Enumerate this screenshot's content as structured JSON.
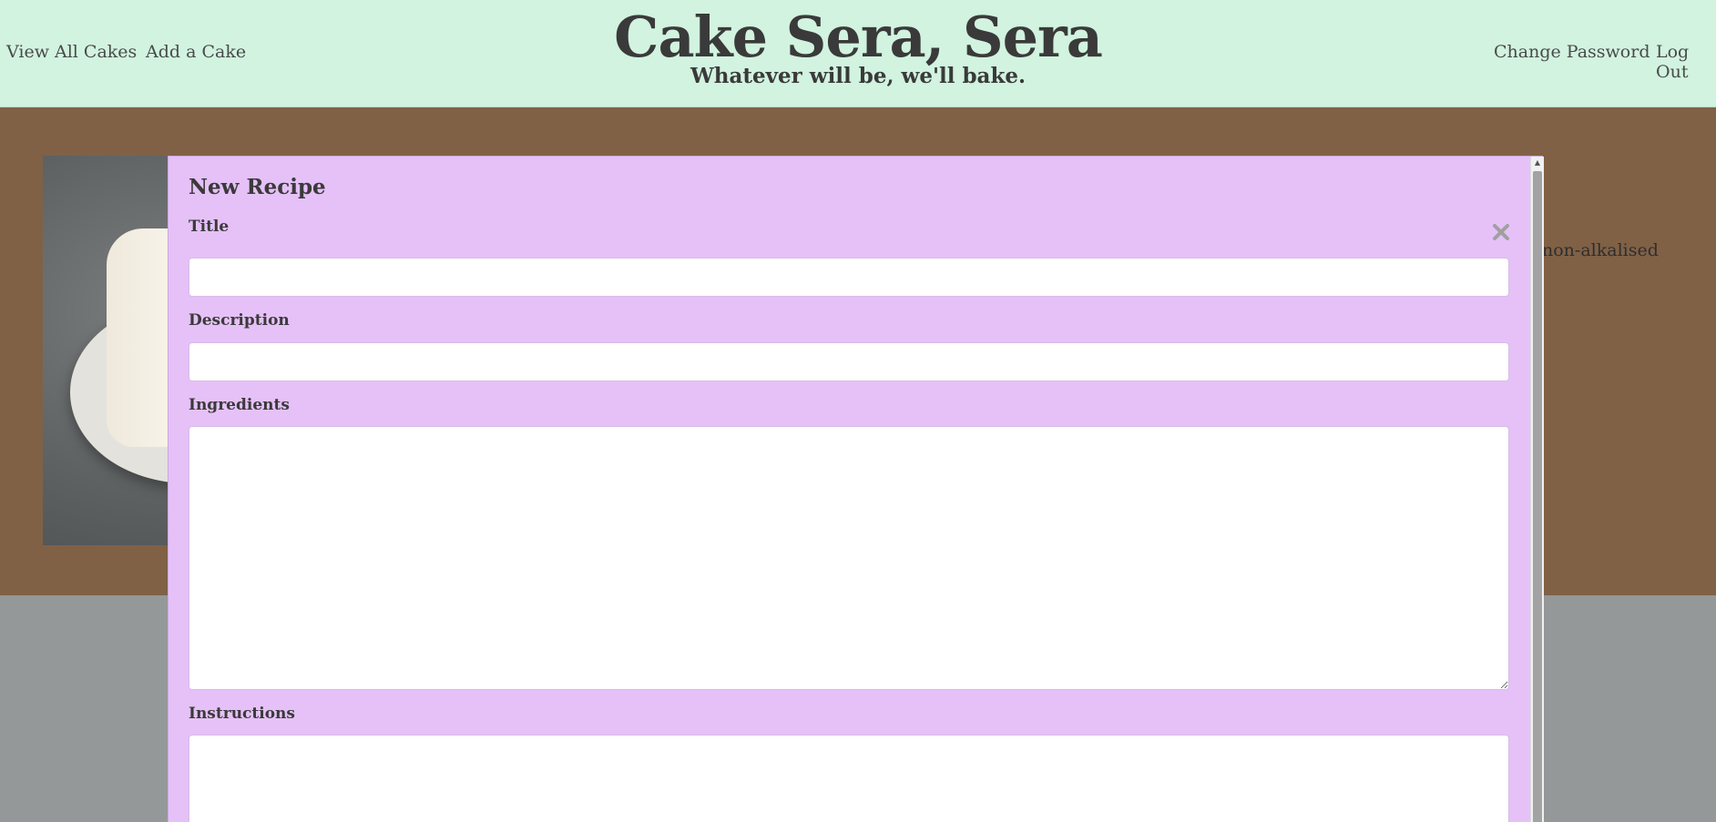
{
  "header": {
    "nav_left": [
      {
        "label": "View All Cakes"
      },
      {
        "label": "Add a Cake"
      }
    ],
    "title": "Cake Sera, Sera",
    "tagline": "Whatever will be, we'll bake.",
    "nav_right": [
      {
        "label": "Change Password"
      },
      {
        "label": "Log Out"
      }
    ]
  },
  "background": {
    "snippet_text": "non-alkalised"
  },
  "modal": {
    "title": "New Recipe",
    "close_icon": "close-icon",
    "fields": {
      "title": {
        "label": "Title",
        "value": ""
      },
      "description": {
        "label": "Description",
        "value": ""
      },
      "ingredients": {
        "label": "Ingredients",
        "value": ""
      },
      "instructions": {
        "label": "Instructions",
        "value": ""
      }
    }
  },
  "colors": {
    "header_bg": "#d1f3e0",
    "band_bg": "#806146",
    "page_bg": "#959899",
    "modal_bg": "#e5c1f8"
  }
}
